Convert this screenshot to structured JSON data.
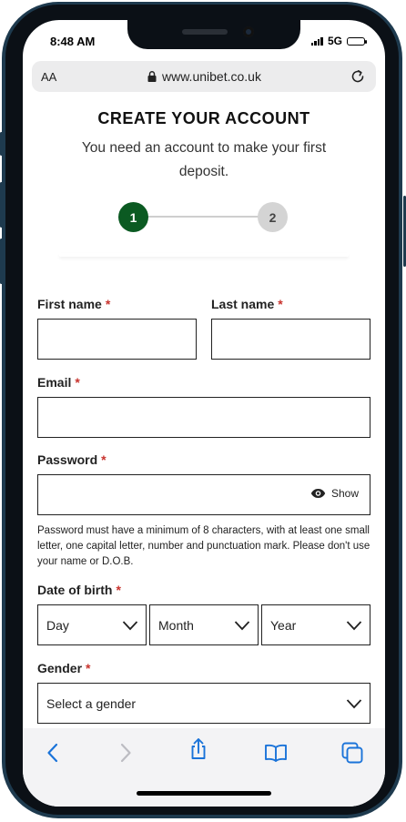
{
  "status": {
    "time": "8:48 AM",
    "network": "5G"
  },
  "browser": {
    "text_size_label": "AA",
    "url": "www.unibet.co.uk"
  },
  "page": {
    "title": "CREATE YOUR ACCOUNT",
    "subtitle": "You need an account to make your first deposit.",
    "steps": [
      "1",
      "2"
    ]
  },
  "form": {
    "required_mark": "*",
    "first_name_label": "First name",
    "last_name_label": "Last name",
    "email_label": "Email",
    "password_label": "Password",
    "password_show": "Show",
    "password_hint": "Password must have a minimum of 8 characters, with at least one small letter, one capital letter, number and punctuation mark. Please don't use your name or D.O.B.",
    "dob_label": "Date of birth",
    "dob_day": "Day",
    "dob_month": "Month",
    "dob_year": "Year",
    "gender_label": "Gender",
    "gender_placeholder": "Select a gender"
  },
  "colors": {
    "brand_green": "#0b5a22",
    "required_red": "#c8332d",
    "ios_blue": "#1a73d9",
    "banner_yellow": "#fbe68c"
  },
  "icons": [
    "lock-icon",
    "reload-icon",
    "eye-icon",
    "chevron-down-icon",
    "back-icon",
    "forward-icon",
    "share-icon",
    "bookmarks-icon",
    "tabs-icon"
  ]
}
